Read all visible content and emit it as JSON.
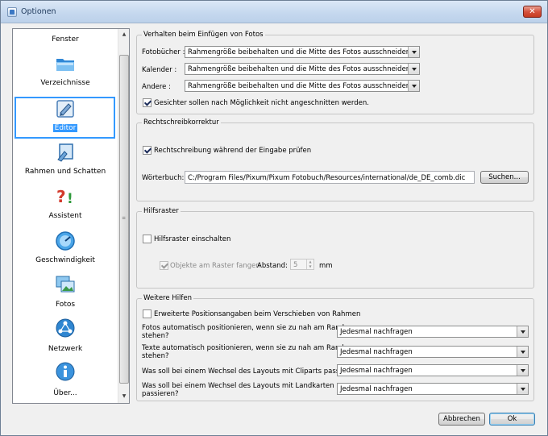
{
  "window": {
    "title": "Optionen",
    "close_glyph": "✕"
  },
  "sidebar": {
    "items": [
      {
        "label": "Fenster",
        "icon": "window-icon"
      },
      {
        "label": "Verzeichnisse",
        "icon": "folder-icon"
      },
      {
        "label": "Editor",
        "icon": "editor-icon",
        "selected": true
      },
      {
        "label": "Rahmen und Schatten",
        "icon": "frame-icon"
      },
      {
        "label": "Assistent",
        "icon": "assistant-icon"
      },
      {
        "label": "Geschwindigkeit",
        "icon": "speed-icon"
      },
      {
        "label": "Fotos",
        "icon": "photos-icon"
      },
      {
        "label": "Netzwerk",
        "icon": "network-icon"
      },
      {
        "label": "Über...",
        "icon": "info-icon"
      }
    ],
    "scroll_up": "▲",
    "scroll_down": "▼"
  },
  "insert_photos": {
    "legend": "Verhalten beim Einfügen von Fotos",
    "photobooks_label": "Fotobücher :",
    "photobooks_value": "Rahmengröße beibehalten und die Mitte des Fotos ausschneiden",
    "calendar_label": "Kalender :",
    "calendar_value": "Rahmengröße beibehalten und die Mitte des Fotos ausschneiden",
    "other_label": "Andere :",
    "other_value": "Rahmengröße beibehalten und die Mitte des Fotos ausschneiden",
    "faces_label": "Gesichter sollen nach Möglichkeit nicht angeschnitten werden."
  },
  "spellcheck": {
    "legend": "Rechtschreibkorrektur",
    "check_label": "Rechtschreibung während der Eingabe prüfen",
    "dict_label": "Wörterbuch:",
    "dict_value": "C:/Program Files/Pixum/Pixum Fotobuch/Resources/international/de_DE_comb.dic",
    "search_button": "Suchen..."
  },
  "grid": {
    "legend": "Hilfsraster",
    "enable_label": "Hilfsraster einschalten",
    "snap_label": "Objekte am Raster fangen",
    "distance_label": "Abstand:",
    "distance_value": "5",
    "unit": "mm"
  },
  "more_help": {
    "legend": "Weitere Hilfen",
    "extended_label": "Erweiterte Positionsangaben beim Verschieben von Rahmen",
    "rows": [
      {
        "label_line1": "Fotos automatisch positionieren, wenn sie zu nah am Rand",
        "label_line2": "stehen?",
        "value": "Jedesmal nachfragen"
      },
      {
        "label_line1": "Texte automatisch positionieren, wenn sie zu nah am Rand",
        "label_line2": "stehen?",
        "value": "Jedesmal nachfragen"
      },
      {
        "label_line1": "Was soll bei einem Wechsel des Layouts mit Cliparts passieren?",
        "label_line2": "",
        "value": "Jedesmal nachfragen"
      },
      {
        "label_line1": "Was soll bei einem Wechsel des Layouts mit Landkarten",
        "label_line2": "passieren?",
        "value": "Jedesmal nachfragen"
      }
    ]
  },
  "footer": {
    "cancel_button": "Abbrechen",
    "ok_button": "Ok"
  },
  "colors": {
    "selection": "#3399ff",
    "title_gradient_top": "#dbe8f6",
    "close_red": "#c53a20"
  }
}
